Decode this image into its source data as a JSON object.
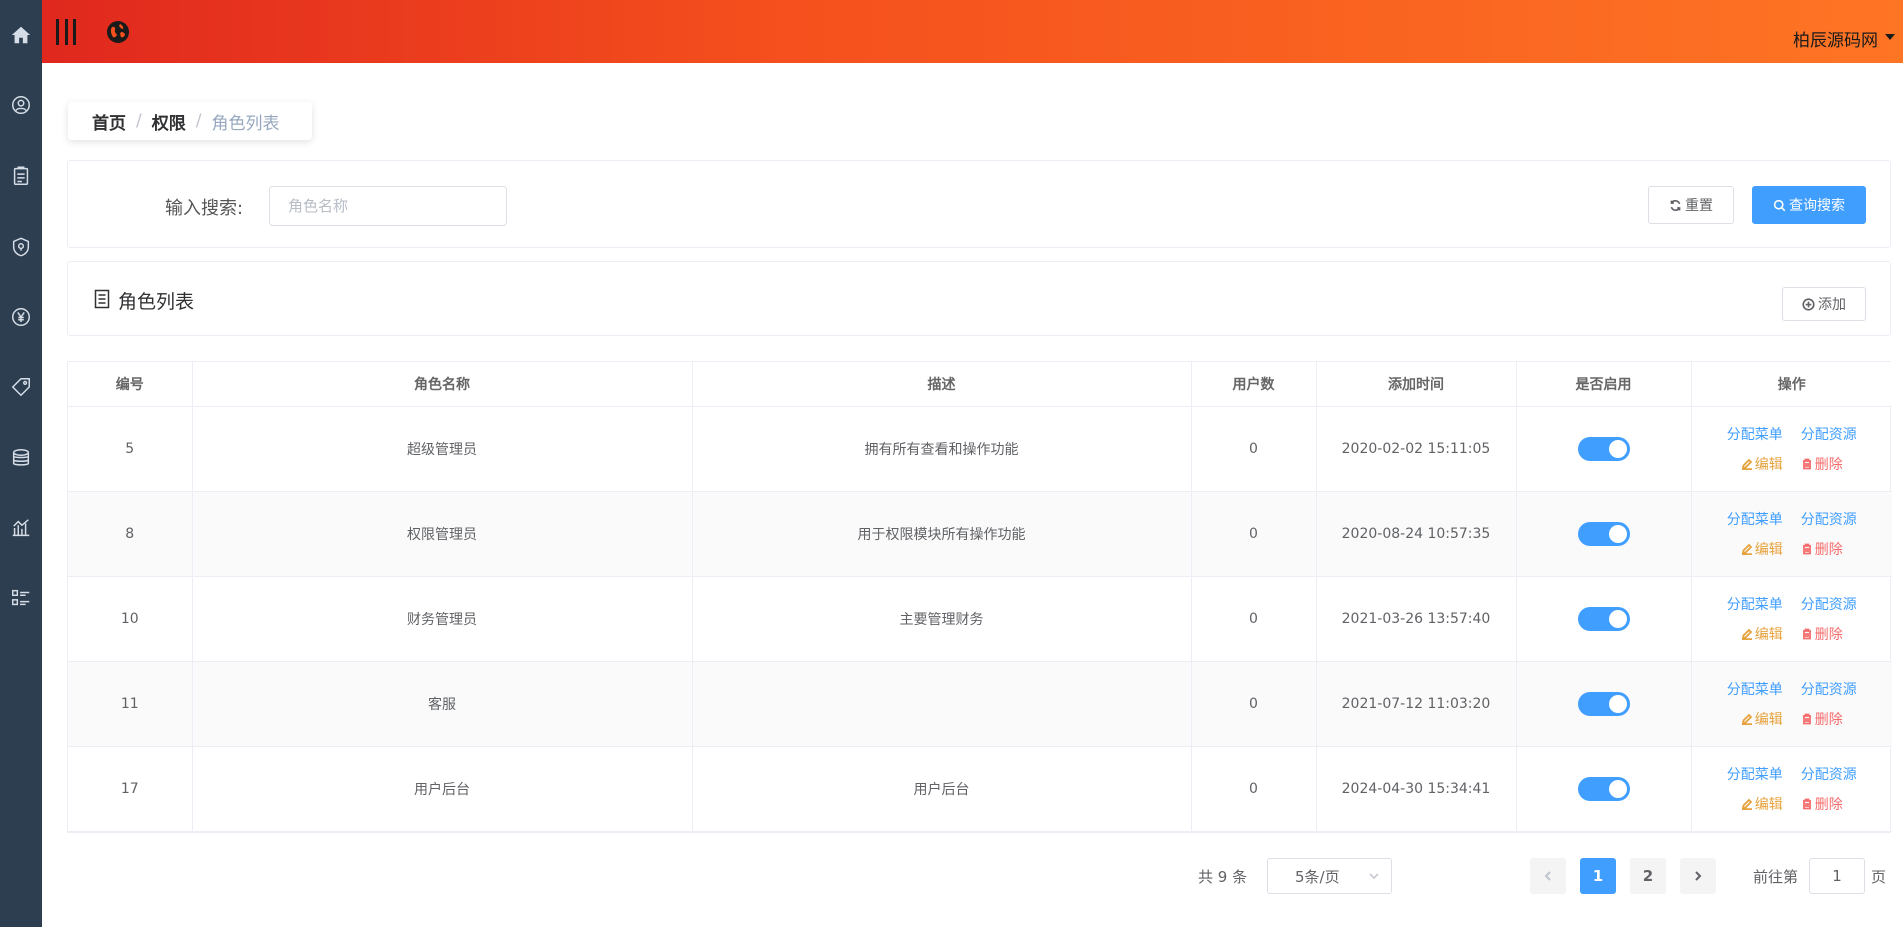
{
  "header": {
    "user_name": "柏辰源码网"
  },
  "sidebar": {
    "icons": [
      "home-icon",
      "user-circle-icon",
      "clipboard-icon",
      "shield-icon",
      "yen-icon",
      "tag-icon",
      "database-icon",
      "chart-icon",
      "list-icon"
    ]
  },
  "breadcrumb": {
    "home": "首页",
    "sep1": "/",
    "section": "权限",
    "sep2": "/",
    "current": "角色列表"
  },
  "search": {
    "label": "输入搜索:",
    "placeholder": "角色名称",
    "reset_label": "重置",
    "search_label": "查询搜索"
  },
  "list": {
    "title": "角色列表",
    "add_label": "添加"
  },
  "table": {
    "columns": [
      "编号",
      "角色名称",
      "描述",
      "用户数",
      "添加时间",
      "是否启用",
      "操作"
    ],
    "rows": [
      {
        "id": "5",
        "name": "超级管理员",
        "desc": "拥有所有查看和操作功能",
        "users": "0",
        "created": "2020-02-02 15:11:05",
        "enabled": true
      },
      {
        "id": "8",
        "name": "权限管理员",
        "desc": "用于权限模块所有操作功能",
        "users": "0",
        "created": "2020-08-24 10:57:35",
        "enabled": true
      },
      {
        "id": "10",
        "name": "财务管理员",
        "desc": "主要管理财务",
        "users": "0",
        "created": "2021-03-26 13:57:40",
        "enabled": true
      },
      {
        "id": "11",
        "name": "客服",
        "desc": "",
        "users": "0",
        "created": "2021-07-12 11:03:20",
        "enabled": true
      },
      {
        "id": "17",
        "name": "用户后台",
        "desc": "用户后台",
        "users": "0",
        "created": "2024-04-30 15:34:41",
        "enabled": true
      }
    ],
    "ops": {
      "assign_menu": "分配菜单",
      "assign_resource": "分配资源",
      "edit": "编辑",
      "delete": "删除"
    }
  },
  "pagination": {
    "total": "共 9 条",
    "page_size": "5条/页",
    "pages": [
      "1",
      "2"
    ],
    "current": "1",
    "goto_label": "前往第",
    "goto_value": "1",
    "goto_suffix": "页"
  },
  "colors": {
    "primary": "#409eff",
    "header_start": "#e0281e",
    "header_end": "#fe7524",
    "sidebar": "#2c3e50",
    "edit": "#e6a23c",
    "delete": "#f56c6c"
  }
}
